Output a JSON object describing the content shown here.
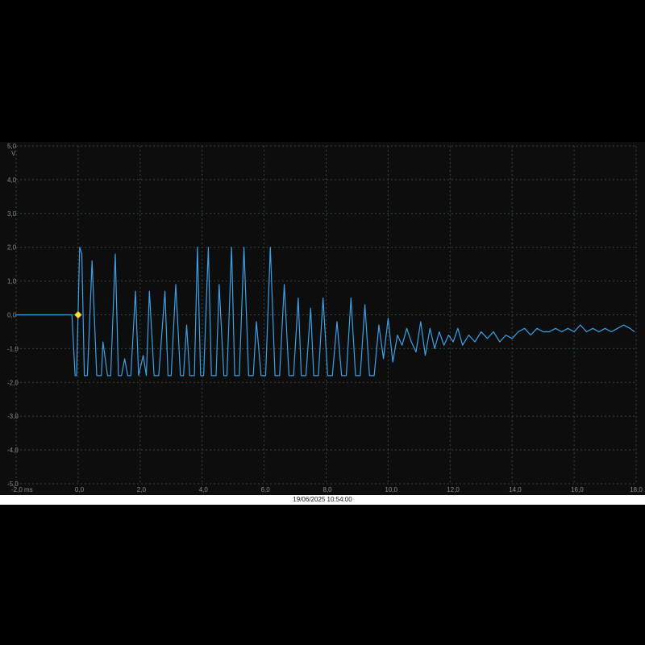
{
  "chart_data": {
    "type": "line",
    "title": "",
    "xlabel": "",
    "ylabel": "",
    "x_unit": "ms",
    "y_unit": "V",
    "xlim": [
      -2.0,
      18.0
    ],
    "ylim": [
      -5.0,
      5.0
    ],
    "grid": true,
    "x_ticks": [
      -2.0,
      0.0,
      2.0,
      4.0,
      6.0,
      8.0,
      10.0,
      12.0,
      14.0,
      16.0,
      18.0
    ],
    "x_tick_labels": [
      "-2,0 ms",
      "0,0",
      "2,0",
      "4,0",
      "6,0",
      "8,0",
      "10,0",
      "12,0",
      "14,0",
      "16,0",
      "18,0"
    ],
    "y_ticks": [
      5.0,
      4.0,
      3.0,
      2.0,
      1.0,
      0.0,
      -1.0,
      -2.0,
      -3.0,
      -4.0,
      -5.0
    ],
    "y_tick_labels": [
      "5,0",
      "4,0",
      "3,0",
      "2,0",
      "1,0",
      "0,0",
      "-1,0",
      "-2,0",
      "-3,0",
      "-4,0",
      "-5,0"
    ],
    "y_unit_label": "V",
    "trigger": {
      "x": 0.0,
      "y": 0.0,
      "color": "#f0e040"
    },
    "series": [
      {
        "color": "#3ca0e6",
        "x": [
          -2.0,
          -0.2,
          -0.1,
          -0.05,
          0.05,
          0.12,
          0.2,
          0.3,
          0.45,
          0.6,
          0.75,
          0.8,
          0.95,
          1.05,
          1.2,
          1.3,
          1.4,
          1.5,
          1.6,
          1.7,
          1.85,
          1.95,
          2.1,
          2.2,
          2.3,
          2.45,
          2.6,
          2.8,
          2.9,
          3.0,
          3.15,
          3.3,
          3.4,
          3.5,
          3.6,
          3.75,
          3.85,
          3.95,
          4.05,
          4.2,
          4.3,
          4.45,
          4.55,
          4.7,
          4.8,
          4.95,
          5.05,
          5.2,
          5.35,
          5.5,
          5.65,
          5.75,
          5.9,
          6.05,
          6.2,
          6.35,
          6.5,
          6.65,
          6.8,
          6.95,
          7.1,
          7.2,
          7.35,
          7.5,
          7.6,
          7.75,
          7.9,
          8.05,
          8.2,
          8.35,
          8.5,
          8.65,
          8.8,
          8.95,
          9.1,
          9.25,
          9.4,
          9.55,
          9.7,
          9.85,
          10.0,
          10.15,
          10.3,
          10.45,
          10.6,
          10.75,
          10.9,
          11.05,
          11.2,
          11.35,
          11.5,
          11.65,
          11.8,
          11.95,
          12.1,
          12.25,
          12.4,
          12.6,
          12.8,
          13.0,
          13.2,
          13.4,
          13.6,
          13.8,
          14.0,
          14.2,
          14.4,
          14.6,
          14.8,
          15.0,
          15.2,
          15.4,
          15.6,
          15.8,
          16.0,
          16.2,
          16.4,
          16.6,
          16.8,
          17.0,
          17.2,
          17.4,
          17.6,
          17.8,
          17.95
        ],
        "y": [
          0.0,
          0.0,
          -1.8,
          -1.8,
          2.0,
          1.8,
          -1.8,
          -1.8,
          1.6,
          -1.8,
          -1.8,
          -0.8,
          -1.8,
          -1.8,
          1.8,
          -1.8,
          -1.8,
          -1.3,
          -1.8,
          -1.8,
          0.7,
          -1.8,
          -1.2,
          -1.8,
          0.7,
          -1.8,
          -1.8,
          0.7,
          -1.8,
          -1.8,
          0.9,
          -1.8,
          -1.8,
          -0.3,
          -1.8,
          -1.8,
          2.0,
          -1.8,
          -1.8,
          2.0,
          -1.8,
          -1.8,
          0.9,
          -1.8,
          -1.8,
          2.0,
          -1.8,
          -1.8,
          2.0,
          -1.8,
          -1.8,
          -0.2,
          -1.8,
          -1.8,
          2.0,
          -1.8,
          -1.8,
          0.9,
          -1.8,
          -1.8,
          0.5,
          -1.8,
          -1.8,
          0.2,
          -1.8,
          -1.8,
          0.5,
          -1.8,
          -1.8,
          -0.2,
          -1.8,
          -1.8,
          0.5,
          -1.8,
          -1.8,
          0.3,
          -1.8,
          -1.8,
          -0.3,
          -1.3,
          -0.1,
          -1.4,
          -0.6,
          -0.9,
          -0.4,
          -0.8,
          -1.1,
          -0.2,
          -1.2,
          -0.4,
          -1.0,
          -0.5,
          -0.9,
          -0.6,
          -0.8,
          -0.4,
          -0.9,
          -0.6,
          -0.8,
          -0.5,
          -0.7,
          -0.5,
          -0.8,
          -0.6,
          -0.7,
          -0.5,
          -0.4,
          -0.6,
          -0.4,
          -0.5,
          -0.5,
          -0.4,
          -0.5,
          -0.4,
          -0.5,
          -0.3,
          -0.5,
          -0.4,
          -0.5,
          -0.4,
          -0.5,
          -0.4,
          -0.3,
          -0.4,
          -0.5
        ]
      }
    ]
  },
  "status": {
    "timestamp": "19/06/2025 10:54:00"
  }
}
